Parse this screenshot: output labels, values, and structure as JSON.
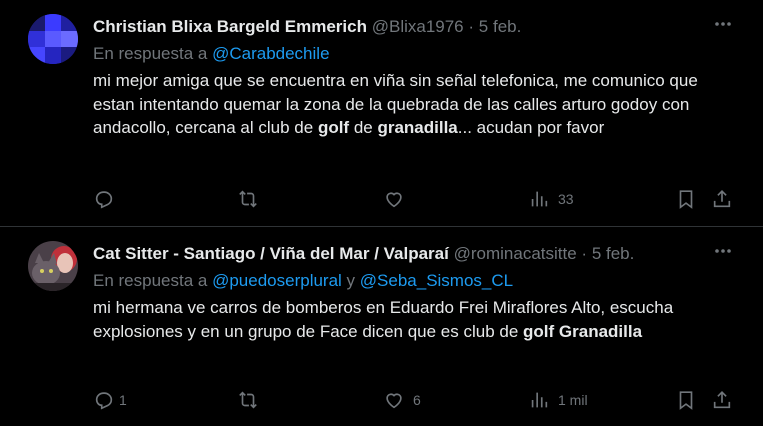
{
  "tweets": [
    {
      "name": "Christian Blixa Bargeld Emmerich",
      "handle": "@Blixa1976",
      "dot": "·",
      "date": "5 feb.",
      "reply_prefix": "En respuesta a",
      "reply_to_1": "@Carabdechile",
      "reply_and": "",
      "reply_to_2": "",
      "body_1": "mi mejor amiga que se encuentra en viña sin señal telefonica, me comunico que estan intentando quemar la zona de la quebrada de las calles arturo godoy con andacollo, cercana al club de ",
      "body_b1": "golf",
      "body_2": " de ",
      "body_b2": "granadilla",
      "body_3": "... acudan por favor",
      "replies": "",
      "retweets": "",
      "likes": "",
      "views": "33"
    },
    {
      "name": "Cat Sitter - Santiago / Viña del Mar / Valparaí",
      "handle": "@rominacatsitte",
      "dot": "·",
      "date": "5 feb.",
      "reply_prefix": "En respuesta a",
      "reply_to_1": "@puedoserplural",
      "reply_and": " y ",
      "reply_to_2": "@Seba_Sismos_CL",
      "body_1": "mi hermana ve carros de bomberos en Eduardo Frei Miraflores Alto, escucha explosiones y en un grupo de Face dicen que es club de ",
      "body_b1": "golf",
      "body_2": " ",
      "body_b2": "Granadilla",
      "body_3": "",
      "replies": "1",
      "retweets": "",
      "likes": "6",
      "views": "1 mil"
    }
  ],
  "icons": {
    "more": "more-horizontal-icon",
    "reply": "reply-icon",
    "retweet": "retweet-icon",
    "like": "heart-icon",
    "views": "views-chart-icon",
    "bookmark": "bookmark-icon",
    "share": "share-icon"
  },
  "colors": {
    "background": "#000000",
    "text": "#e7e9ea",
    "muted": "#71767b",
    "link": "#1d9bf0",
    "divider": "#2f3336"
  }
}
